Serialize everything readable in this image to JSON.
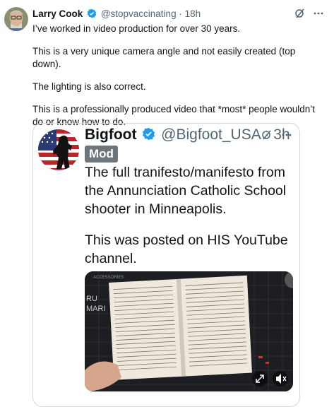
{
  "tweet": {
    "author_name": "Larry Cook",
    "handle": "@stopvaccinating",
    "dot": "·",
    "time": "18h",
    "paragraphs": [
      "I’ve worked in video production for over 30 years.",
      "This is a very unique camera angle and not easily created (top down).",
      "The lighting is also correct.",
      "This is a professionally produced video that *most* people wouldn’t do or know how to do."
    ]
  },
  "quote": {
    "author_name": "Bigfoot",
    "handle": "@Bigfoot_USA",
    "dot": "·",
    "time": "3h",
    "badge": "Mod",
    "paragraphs": [
      "The full tranifesto/manifesto from the Annunciation Catholic School shooter in Minneapolis.",
      "This was posted on HIS YouTube channel."
    ]
  },
  "media": {
    "overlay_text_top": "ACCESSORIES",
    "overlay_text_left": "RU\nMARI"
  },
  "icons": {
    "verified": "verified-badge-icon",
    "grok": "grok-icon",
    "more": "more-icon",
    "expand": "expand-icon",
    "mute": "mute-icon"
  },
  "colors": {
    "verified": "#1d9bf0",
    "muted_text": "#536471",
    "badge_bg": "#6e767d"
  }
}
